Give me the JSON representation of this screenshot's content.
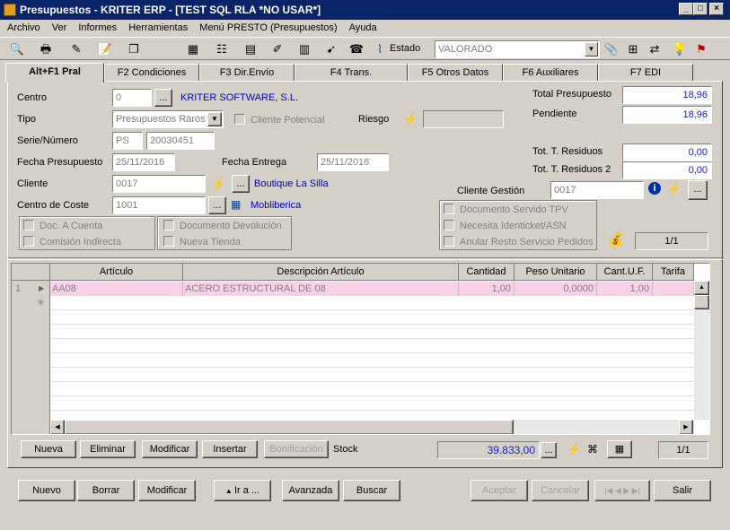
{
  "window": {
    "title": "Presupuestos - KRITER ERP - [TEST SQL RLA *NO USAR*]"
  },
  "menu": [
    "Archivo",
    "Ver",
    "Informes",
    "Herramientas",
    "Menú PRESTO (Presupuestos)",
    "Ayuda"
  ],
  "toolbar": {
    "estado_label": "Estado",
    "estado_value": "VALORADO"
  },
  "tabs": [
    "Alt+F1 Pral",
    "F2 Condiciones",
    "F3 Dir.Envío",
    "F4 Trans.",
    "F5 Otros Datos",
    "F6 Auxiliares",
    "F7 EDI"
  ],
  "form": {
    "centro_label": "Centro",
    "centro_value": "0",
    "centro_name": "KRITER SOFTWARE, S.L.",
    "tipo_label": "Tipo",
    "tipo_value": "Presupuestos Raros",
    "cliente_potencial": "Cliente Potencial",
    "riesgo_label": "Riesgo",
    "serie_label": "Serie/Número",
    "serie_value": "PS",
    "numero_value": "20030451",
    "fecha_pres_label": "Fecha Presupuesto",
    "fecha_pres_value": "25/11/2016",
    "fecha_ent_label": "Fecha Entrega",
    "fecha_ent_value": "25/11/2016",
    "cliente_label": "Cliente",
    "cliente_value": "0017",
    "cliente_name": "Boutique La Silla",
    "coste_label": "Centro de Coste",
    "coste_value": "1001",
    "coste_name": "Mobliberica",
    "cliente_gestion_label": "Cliente Gestión",
    "cliente_gestion_value": "0017",
    "total_label": "Total Presupuesto",
    "total_value": "18,96",
    "pendiente_label": "Pendiente",
    "pendiente_value": "18,96",
    "residuos_label": "Tot. T. Residuos",
    "residuos_value": "0,00",
    "residuos2_label": "Tot. T. Residuos 2",
    "residuos2_value": "0,00",
    "chk_doc_cuenta": "Doc. A Cuenta",
    "chk_comision": "Comisión Indirecta",
    "chk_devolucion": "Documento Devolución",
    "chk_tienda": "Nueva Tienda",
    "chk_tpv": "Documento Servido TPV",
    "chk_identicket": "Necesita Identicket/ASN",
    "chk_anular": "Anular Resto Servicio Pedidos",
    "page_counter": "1/1"
  },
  "grid": {
    "columns": [
      "Artículo",
      "Descripción Artículo",
      "Cantidad",
      "Peso Unitario",
      "Cant.U.F.",
      "Tarifa"
    ],
    "rows": [
      {
        "num": "1",
        "articulo": "AA08",
        "descripcion": "ACERO ESTRUCTURAL DE 08",
        "cantidad": "1,00",
        "peso": "0,0000",
        "cantuf": "1,00",
        "tarifa": ""
      }
    ]
  },
  "lines": {
    "nueva": "Nueva",
    "eliminar": "Eliminar",
    "modificar": "Modificar",
    "insertar": "Insertar",
    "bonificacion": "Bonificación",
    "stock_label": "Stock",
    "stock_value": "39.833,00",
    "counter": "1/1"
  },
  "bottom": {
    "nuevo": "Nuevo",
    "borrar": "Borrar",
    "modificar": "Modificar",
    "ira": "Ir a ...",
    "avanzada": "Avanzada",
    "buscar": "Buscar",
    "aceptar": "Aceptar",
    "cancelar": "Cancelar",
    "salir": "Salir"
  }
}
